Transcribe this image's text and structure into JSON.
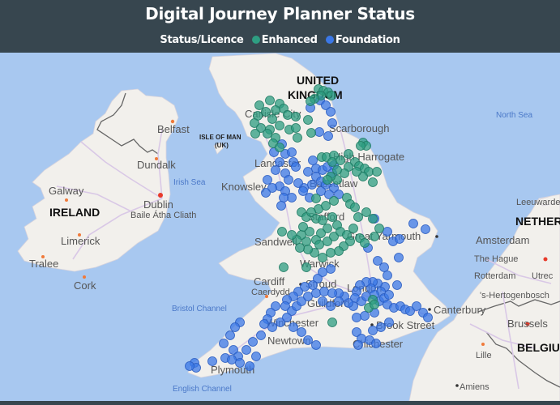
{
  "header": {
    "title": "Digital Journey Planner Status",
    "legend_title": "Status/Licence",
    "legend": [
      {
        "label": "Enhanced",
        "color": "#2e9e82"
      },
      {
        "label": "Foundation",
        "color": "#3b78e7"
      }
    ]
  },
  "map": {
    "water_color": "#a8c8f0",
    "land_color": "#f2f0ec",
    "labels": {
      "united": "UNITED",
      "kingdom": "KINGDOM",
      "ireland": "IRELAND",
      "isle_of_man": "ISLE OF MAN",
      "uk": "(UK)",
      "netherlands": "NETHER",
      "belgium": "BELGIU",
      "north_sea": "North Sea",
      "irish_sea": "Irish Sea",
      "bristol_channel": "Bristol Channel",
      "english_channel": "English Channel",
      "belfast": "Belfast",
      "dundalk": "Dundalk",
      "galway": "Galway",
      "dublin": "Dublin",
      "dublin_irish": "Baile Átha Cliath",
      "limerick": "Limerick",
      "tralee": "Tralee",
      "cork": "Cork",
      "carlisle": "Carlisle City",
      "scarborough": "Scarborough",
      "harrogate": "High Harrogate",
      "lancaster": "Lancaster",
      "knowsley": "Knowsley",
      "bassetlaw": "Bassetlaw",
      "stafford": "Stafford",
      "sandwell": "Sandwell",
      "great_yarmouth": "Great Yarmouth",
      "warwick": "Warwick",
      "cardiff": "Cardiff",
      "caerdydd": "Caerdydd",
      "stroud": "Stroud",
      "london": "London",
      "guildford": "Guildford",
      "canterbury": "Canterbury",
      "winchester": "Winchester",
      "brook_street": "Brook Street",
      "newtown": "Newtown",
      "chichester": "Chichester",
      "plymouth": "Plymouth",
      "leeuwarden": "Leeuwarden",
      "amsterdam": "Amsterdam",
      "the_hague": "The Hague",
      "rotterdam": "Rotterdam",
      "utrecht": "Utrec",
      "hertogenbosch": "'s-Hertogenbosch",
      "brussels": "Brussels",
      "lille": "Lille",
      "amiens": "Amiens"
    },
    "points": {
      "enhanced": [
        [
          393,
          110
        ],
        [
          399,
          112
        ],
        [
          405,
          114
        ],
        [
          396,
          118
        ],
        [
          409,
          118
        ],
        [
          388,
          122
        ],
        [
          383,
          125
        ],
        [
          320,
          130
        ],
        [
          333,
          124
        ],
        [
          345,
          128
        ],
        [
          350,
          134
        ],
        [
          340,
          136
        ],
        [
          328,
          138
        ],
        [
          318,
          143
        ],
        [
          336,
          147
        ],
        [
          355,
          142
        ],
        [
          365,
          144
        ],
        [
          314,
          152
        ],
        [
          322,
          158
        ],
        [
          333,
          160
        ],
        [
          345,
          155
        ],
        [
          357,
          160
        ],
        [
          315,
          165
        ],
        [
          330,
          165
        ],
        [
          340,
          170
        ],
        [
          365,
          158
        ],
        [
          380,
          148
        ],
        [
          337,
          177
        ],
        [
          345,
          182
        ],
        [
          367,
          170
        ],
        [
          384,
          164
        ],
        [
          448,
          176
        ],
        [
          452,
          180
        ],
        [
          445,
          180
        ],
        [
          397,
          194
        ],
        [
          403,
          194
        ],
        [
          412,
          192
        ],
        [
          410,
          200
        ],
        [
          420,
          198
        ],
        [
          430,
          190
        ],
        [
          438,
          200
        ],
        [
          443,
          205
        ],
        [
          450,
          208
        ],
        [
          455,
          212
        ],
        [
          465,
          212
        ],
        [
          460,
          225
        ],
        [
          448,
          218
        ],
        [
          440,
          212
        ],
        [
          430,
          206
        ],
        [
          425,
          214
        ],
        [
          416,
          210
        ],
        [
          416,
          222
        ],
        [
          408,
          218
        ],
        [
          404,
          222
        ],
        [
          390,
          245
        ],
        [
          393,
          258
        ],
        [
          402,
          254
        ],
        [
          412,
          248
        ],
        [
          428,
          244
        ],
        [
          432,
          252
        ],
        [
          438,
          256
        ],
        [
          442,
          268
        ],
        [
          452,
          262
        ],
        [
          460,
          270
        ],
        [
          468,
          282
        ],
        [
          462,
          292
        ],
        [
          372,
          262
        ],
        [
          378,
          268
        ],
        [
          384,
          262
        ],
        [
          390,
          270
        ],
        [
          398,
          272
        ],
        [
          410,
          268
        ],
        [
          416,
          278
        ],
        [
          404,
          282
        ],
        [
          396,
          288
        ],
        [
          390,
          296
        ],
        [
          378,
          298
        ],
        [
          372,
          290
        ],
        [
          382,
          286
        ],
        [
          394,
          302
        ],
        [
          404,
          298
        ],
        [
          412,
          292
        ],
        [
          420,
          286
        ],
        [
          428,
          290
        ],
        [
          432,
          298
        ],
        [
          424,
          304
        ],
        [
          418,
          310
        ],
        [
          408,
          312
        ],
        [
          398,
          318
        ],
        [
          388,
          312
        ],
        [
          380,
          308
        ],
        [
          370,
          306
        ],
        [
          366,
          296
        ],
        [
          360,
          290
        ],
        [
          348,
          286
        ],
        [
          374,
          280
        ],
        [
          436,
          282
        ],
        [
          444,
          294
        ],
        [
          450,
          300
        ],
        [
          350,
          330
        ],
        [
          378,
          330
        ],
        [
          410,
          398
        ],
        [
          460,
          370
        ],
        [
          455,
          380
        ],
        [
          462,
          376
        ]
      ],
      "foundation": [
        [
          395,
          124
        ],
        [
          402,
          130
        ],
        [
          408,
          138
        ],
        [
          383,
          133
        ],
        [
          410,
          152
        ],
        [
          394,
          163
        ],
        [
          405,
          168
        ],
        [
          348,
          178
        ],
        [
          352,
          190
        ],
        [
          362,
          200
        ],
        [
          345,
          200
        ],
        [
          340,
          210
        ],
        [
          352,
          214
        ],
        [
          365,
          206
        ],
        [
          380,
          212
        ],
        [
          390,
          208
        ],
        [
          398,
          210
        ],
        [
          404,
          206
        ],
        [
          410,
          214
        ],
        [
          390,
          218
        ],
        [
          396,
          224
        ],
        [
          385,
          228
        ],
        [
          375,
          232
        ],
        [
          368,
          226
        ],
        [
          356,
          222
        ],
        [
          345,
          230
        ],
        [
          336,
          232
        ],
        [
          328,
          238
        ],
        [
          352,
          236
        ],
        [
          360,
          244
        ],
        [
          374,
          236
        ],
        [
          382,
          244
        ],
        [
          402,
          228
        ],
        [
          412,
          232
        ],
        [
          418,
          240
        ],
        [
          396,
          236
        ],
        [
          412,
          204
        ],
        [
          386,
          198
        ],
        [
          360,
          188
        ],
        [
          338,
          188
        ],
        [
          330,
          222
        ],
        [
          350,
          244
        ],
        [
          347,
          254
        ],
        [
          406,
          240
        ],
        [
          462,
          270
        ],
        [
          478,
          286
        ],
        [
          485,
          298
        ],
        [
          493,
          295
        ],
        [
          510,
          276
        ],
        [
          525,
          283
        ],
        [
          492,
          318
        ],
        [
          466,
          322
        ],
        [
          474,
          330
        ],
        [
          454,
          306
        ],
        [
          478,
          340
        ],
        [
          490,
          352
        ],
        [
          475,
          354
        ],
        [
          470,
          360
        ],
        [
          466,
          350
        ],
        [
          460,
          348
        ],
        [
          452,
          348
        ],
        [
          444,
          352
        ],
        [
          440,
          360
        ],
        [
          438,
          368
        ],
        [
          446,
          372
        ],
        [
          452,
          366
        ],
        [
          458,
          356
        ],
        [
          462,
          364
        ],
        [
          468,
          372
        ],
        [
          474,
          368
        ],
        [
          480,
          364
        ],
        [
          478,
          376
        ],
        [
          486,
          380
        ],
        [
          494,
          378
        ],
        [
          500,
          382
        ],
        [
          506,
          384
        ],
        [
          514,
          378
        ],
        [
          522,
          386
        ],
        [
          528,
          392
        ],
        [
          462,
          386
        ],
        [
          450,
          390
        ],
        [
          440,
          392
        ],
        [
          436,
          378
        ],
        [
          430,
          374
        ],
        [
          425,
          366
        ],
        [
          418,
          362
        ],
        [
          408,
          332
        ],
        [
          398,
          336
        ],
        [
          392,
          344
        ],
        [
          386,
          352
        ],
        [
          376,
          354
        ],
        [
          368,
          360
        ],
        [
          362,
          366
        ],
        [
          354,
          370
        ],
        [
          352,
          378
        ],
        [
          360,
          384
        ],
        [
          366,
          378
        ],
        [
          372,
          372
        ],
        [
          380,
          366
        ],
        [
          390,
          362
        ],
        [
          400,
          360
        ],
        [
          410,
          362
        ],
        [
          418,
          372
        ],
        [
          408,
          378
        ],
        [
          398,
          372
        ],
        [
          340,
          378
        ],
        [
          334,
          386
        ],
        [
          330,
          394
        ],
        [
          326,
          400
        ],
        [
          336,
          404
        ],
        [
          346,
          398
        ],
        [
          354,
          392
        ],
        [
          362,
          404
        ],
        [
          372,
          410
        ],
        [
          380,
          420
        ],
        [
          390,
          426
        ],
        [
          440,
          410
        ],
        [
          446,
          418
        ],
        [
          456,
          420
        ],
        [
          464,
          424
        ],
        [
          442,
          426
        ],
        [
          460,
          408
        ],
        [
          470,
          404
        ],
        [
          480,
          398
        ],
        [
          296,
          398
        ],
        [
          290,
          404
        ],
        [
          284,
          414
        ],
        [
          276,
          424
        ],
        [
          288,
          432
        ],
        [
          294,
          440
        ],
        [
          304,
          432
        ],
        [
          312,
          422
        ],
        [
          322,
          414
        ],
        [
          240,
          448
        ],
        [
          242,
          454
        ],
        [
          262,
          446
        ],
        [
          278,
          442
        ],
        [
          286,
          444
        ],
        [
          296,
          448
        ],
        [
          308,
          452
        ],
        [
          316,
          440
        ],
        [
          234,
          452
        ]
      ]
    }
  }
}
